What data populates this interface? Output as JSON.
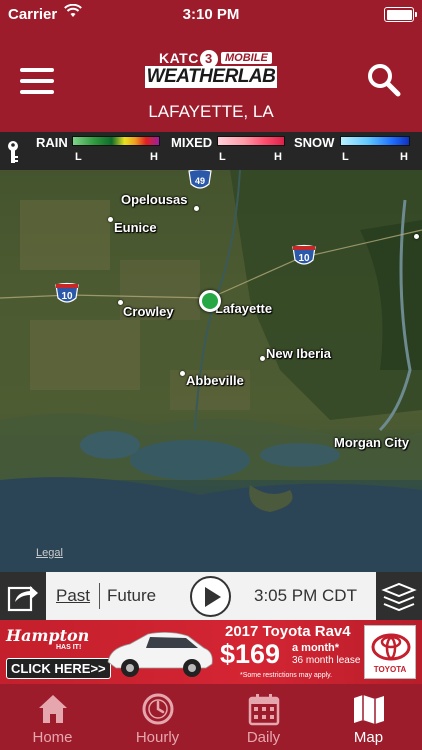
{
  "status_bar": {
    "carrier": "Carrier",
    "time": "3:10 PM"
  },
  "header": {
    "logo": {
      "station": "KATC",
      "station_number": "3",
      "mobile": "MOBILE",
      "brand": "WEATHERLAB"
    },
    "location": "LAFAYETTE, LA"
  },
  "legend": {
    "rain": {
      "label": "RAIN",
      "low": "L",
      "high": "H"
    },
    "mixed": {
      "label": "MIXED",
      "low": "L",
      "high": "H"
    },
    "snow": {
      "label": "SNOW",
      "low": "L",
      "high": "H"
    }
  },
  "map": {
    "cities": {
      "opelousas": "Opelousas",
      "eunice": "Eunice",
      "crowley": "Crowley",
      "lafayette": "Lafayette",
      "new_iberia": "New Iberia",
      "abbeville": "Abbeville",
      "morgan_city": "Morgan City"
    },
    "highways": {
      "i10_west": "10",
      "i10_east": "10",
      "i49": "49"
    },
    "legal": "Legal"
  },
  "controls": {
    "past": "Past",
    "future": "Future",
    "time": "3:05 PM CDT"
  },
  "ad": {
    "brand": "Hampton",
    "brand_sub": "HAS IT!",
    "click": "CLICK HERE>>",
    "title": "2017 Toyota Rav4",
    "price": "$169",
    "per_month": "a month*",
    "lease": "36 month lease",
    "restrictions": "*Some restrictions may apply.",
    "logo_text": "TOYOTA"
  },
  "tabs": [
    {
      "label": "Home",
      "icon": "home-icon",
      "active": false
    },
    {
      "label": "Hourly",
      "icon": "clock-icon",
      "active": false
    },
    {
      "label": "Daily",
      "icon": "calendar-icon",
      "active": false
    },
    {
      "label": "Map",
      "icon": "map-icon",
      "active": true
    }
  ],
  "colors": {
    "brand": "#9c1c2c",
    "legend_bg": "#262626",
    "marker": "#28a745",
    "tab_inactive": "#e6a6ad"
  }
}
